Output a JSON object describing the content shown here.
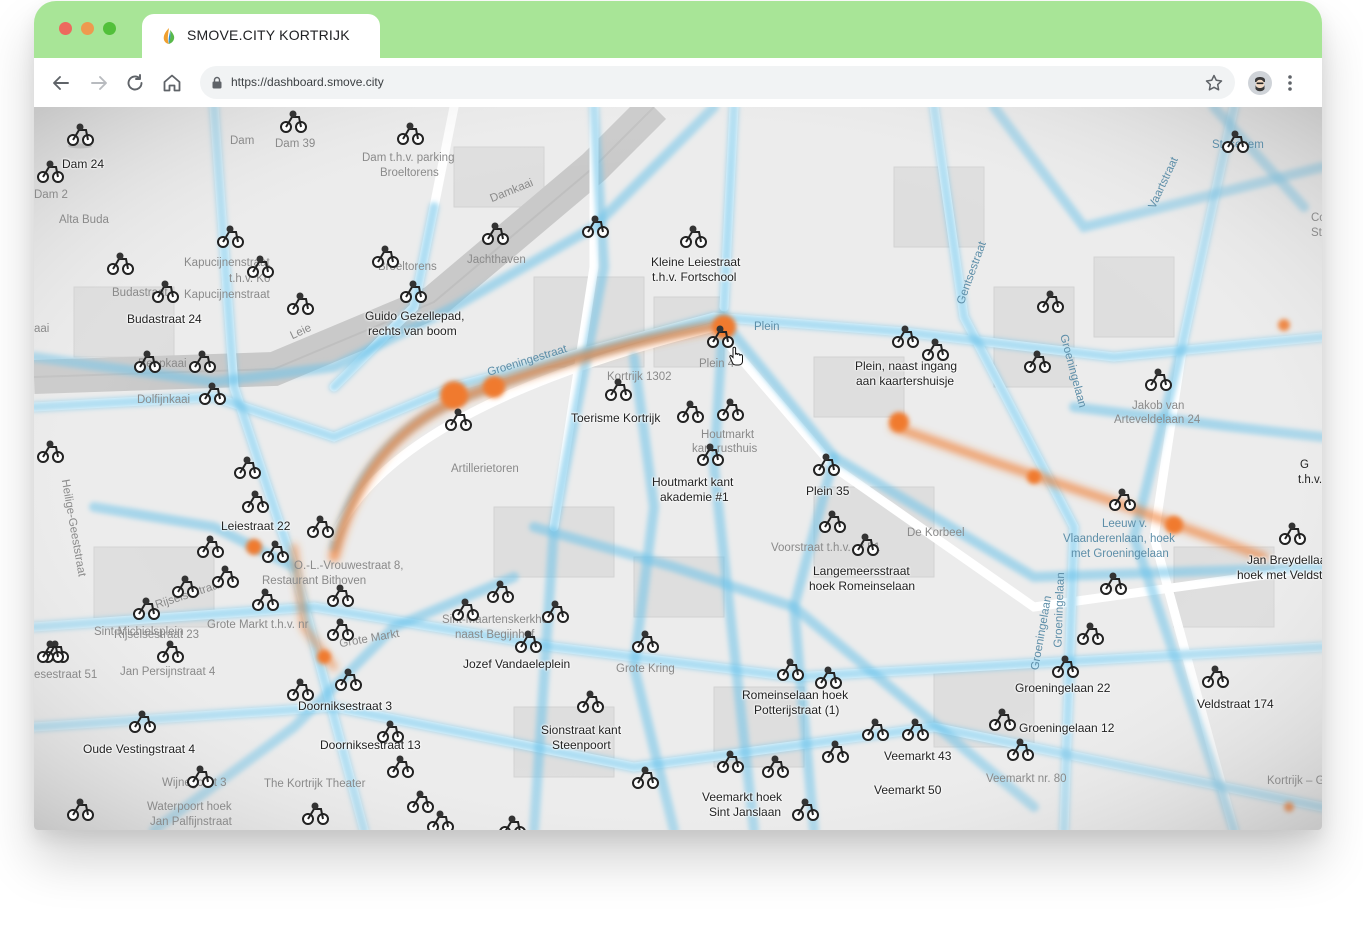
{
  "browser": {
    "tab_title": "SMOVE.CITY KORTRIJK",
    "url": "https://dashboard.smove.city",
    "colors": {
      "frame": "#a8e597",
      "heat_low": "#6bc3ea",
      "heat_high": "#f07a2e"
    }
  },
  "map": {
    "streets": [
      "Dam",
      "Dam 39",
      "Dam t.h.v. parking",
      "Broeltorens",
      "Damkaai",
      "Alta Buda",
      "Budastraat",
      "Kapucijnenstraat",
      "t.h.v. Ko",
      "Kapucijnenstraat",
      "Broeltorens",
      "Jachthaven",
      "Leie",
      "Kortrijk 1302",
      "Groeningestraat",
      "Plein",
      "Plein 4",
      "Artillerietoren",
      "Houtmarkt",
      "kant rusthuis",
      "Dolfijnkaai",
      "Reepkaai",
      "Gentsestraat",
      "Groeningelaan",
      "Jakob van",
      "Arteveldelaan 24",
      "De Korbeel",
      "Voorstraat t.h.v. nr 51",
      "Leeuw v.",
      "Vlaanderenlaan, hoek",
      "met Groeningelaan",
      "Groeningelaan",
      "Groeningelaan",
      "Heilige-Geeststraat",
      "O.-L.-Vrouwestraat 8,",
      "Restaurant Bithoven",
      "Grote Markt t.h.v. nr",
      "Grote Markt",
      "Sint-Maartenskerkhof",
      "naast Begijnhof",
      "Grote Kring",
      "Jan Persijnstraat 4",
      "Sint-Michielsplein",
      "Rijselsestraat 23",
      "Rijselsestraat",
      "esestraat 51",
      "Veemarkt nr. 80",
      "The Kortrijk Theater",
      "Waterpoort hoek",
      "Jan Palfijnstraat",
      "Wijnegoort 3",
      "Kortrijk – Gro",
      "t.h.v.",
      "Vaartstraat",
      "Stasegem",
      "Co",
      "St",
      "G",
      "aai",
      "Dam 2"
    ],
    "stations": [
      "Dam 24",
      "Budastraat 24",
      "Guido Gezellepad,",
      "rechts van boom",
      "Kleine Leiestraat",
      "t.h.v. Fortschool",
      "Plein, naast ingang",
      "aan kaartershuisje",
      "Toerisme Kortrijk",
      "Houtmarkt kant",
      "akademie #1",
      "Plein 35",
      "Leiestraat 22",
      "Langemeersstraat",
      "hoek Romeinselaan",
      "Jan Breydellaan",
      "hoek met Veldstraat",
      "Jozef Vandaeleplein",
      "Sionstraat kant",
      "Steenpoort",
      "Romeinselaan hoek",
      "Potterijstraat (1)",
      "Groeningelaan 22",
      "Groeningelaan 12",
      "Veldstraat 174",
      "Veemarkt 43",
      "Veemarkt 50",
      "Veemarkt hoek",
      "Sint Janslaan",
      "Doorniksestraat 3",
      "Doorniksestraat 13",
      "Oude Vestingstraat 4"
    ]
  }
}
